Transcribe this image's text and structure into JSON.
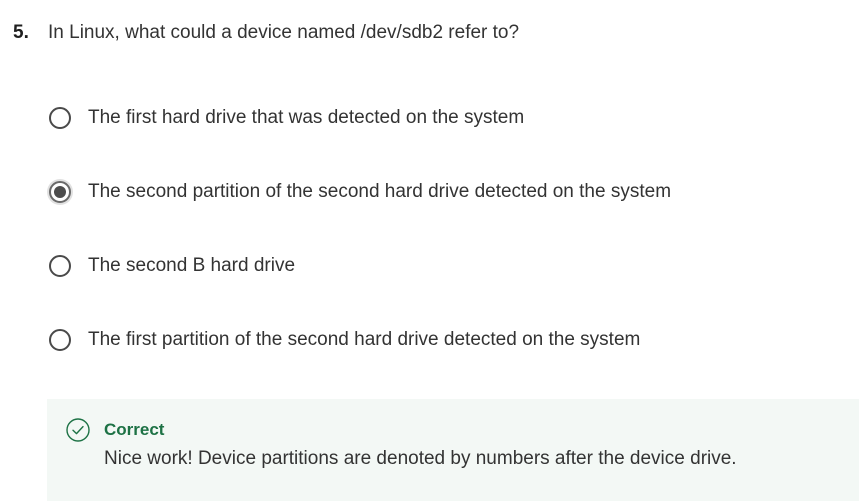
{
  "question": {
    "number": "5.",
    "text": "In Linux, what could a device named /dev/sdb2 refer to?"
  },
  "options": [
    {
      "label": "The first hard drive that was detected on the system",
      "selected": false
    },
    {
      "label": "The second partition of the second hard drive detected on the system",
      "selected": true
    },
    {
      "label": "The second B hard drive",
      "selected": false
    },
    {
      "label": "The first partition of the second hard drive detected on the system",
      "selected": false
    }
  ],
  "feedback": {
    "icon": "check-circle-icon",
    "status": "Correct",
    "message": "Nice work! Device partitions are denoted by numbers after the device drive.",
    "accent_color": "#1d7245",
    "background_color": "#f3f8f5"
  }
}
